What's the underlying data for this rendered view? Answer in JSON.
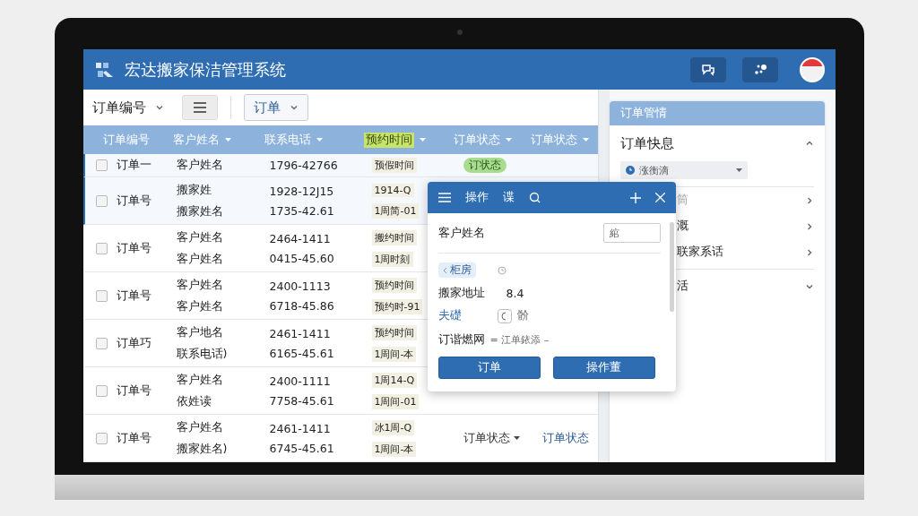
{
  "header": {
    "title": "宏达搬家保洁管理系统"
  },
  "toolbar": {
    "filter": "订单编号",
    "view": "订单"
  },
  "table": {
    "columns": [
      {
        "label": "订单编号",
        "sortable": false,
        "highlighted": false
      },
      {
        "label": "客户姓名",
        "sortable": true,
        "highlighted": false
      },
      {
        "label": "联系电话",
        "sortable": true,
        "highlighted": false
      },
      {
        "label": "预约时间",
        "sortable": true,
        "highlighted": true
      },
      {
        "label": "订单状态",
        "sortable": true,
        "highlighted": false
      },
      {
        "label": "订单状态",
        "sortable": true,
        "highlighted": false
      }
    ],
    "rows": [
      {
        "selected": true,
        "checked": false,
        "order": "订单一",
        "customer": [
          "客户姓名"
        ],
        "phone": [
          "1796-42766"
        ],
        "time": [
          "预假时间"
        ],
        "status": [
          {
            "kind": "badge",
            "text": "订状态"
          }
        ]
      },
      {
        "selected": true,
        "checked": false,
        "order": "订单号",
        "customer": [
          "搬家姓",
          "搬家姓名"
        ],
        "phone": [
          "1928-12J15",
          "1735-42.61"
        ],
        "time": [
          "1914-Q",
          "1周简-01"
        ]
      },
      {
        "selected": false,
        "checked": false,
        "order": "订单号",
        "customer": [
          "客户姓名",
          "客户姓名"
        ],
        "phone": [
          "2464-1411",
          "0415-45.60"
        ],
        "time": [
          "搬约时间",
          "1周时刻"
        ]
      },
      {
        "selected": false,
        "checked": false,
        "order": "订单号",
        "customer": [
          "客户姓名",
          "客户姓名"
        ],
        "phone": [
          "2400-1113",
          "6718-45.86"
        ],
        "time": [
          "预约时间",
          "预约时-91"
        ]
      },
      {
        "selected": false,
        "checked": false,
        "order": "订单巧",
        "customer": [
          "客户地名",
          "联系电话)"
        ],
        "phone": [
          "2461-1411",
          "6165-45.61"
        ],
        "time": [
          "预约时间",
          "1周间-本"
        ]
      },
      {
        "selected": false,
        "checked": false,
        "order": "订单号",
        "customer": [
          "客户姓名",
          "依姓读"
        ],
        "phone": [
          "2400-1111",
          "7758-45.61"
        ],
        "time": [
          "1周14-Q",
          "1周间-01"
        ]
      },
      {
        "selected": false,
        "checked": false,
        "order": "订单号",
        "customer": [
          "客户姓名",
          "搬家姓名)"
        ],
        "phone": [
          "2461-1411",
          "6745-45.61"
        ],
        "time": [
          "冰1周-Q",
          "1周间-本"
        ],
        "status": [
          {
            "kind": "dropdown",
            "text": "订单状态"
          },
          {
            "kind": "link",
            "text": "订单状态"
          }
        ]
      }
    ]
  },
  "sidebar": {
    "title": "订单管情",
    "section": {
      "title": "订单快息",
      "expanded": true,
      "select": "涨衡滴"
    },
    "items": [
      {
        "label": "筒",
        "kind": "nav",
        "disabled": true
      },
      {
        "label": "溉",
        "kind": "nav",
        "disabled": false
      },
      {
        "label": "联家系话",
        "kind": "nav",
        "disabled": false
      },
      {
        "label": "活",
        "kind": "group",
        "disabled": false
      }
    ]
  },
  "dialog": {
    "tabs": [
      "操作",
      "谍"
    ],
    "field": {
      "label": "客户姓名",
      "value": "綰"
    },
    "tag": "柜房",
    "address": {
      "label": "搬家地址",
      "value": "8.4"
    },
    "link": "夫礎",
    "option": "骱",
    "status": {
      "label": "订谐燃网",
      "value": "= 江单銥添 –"
    },
    "buttons": [
      "订单",
      "操作董"
    ]
  }
}
